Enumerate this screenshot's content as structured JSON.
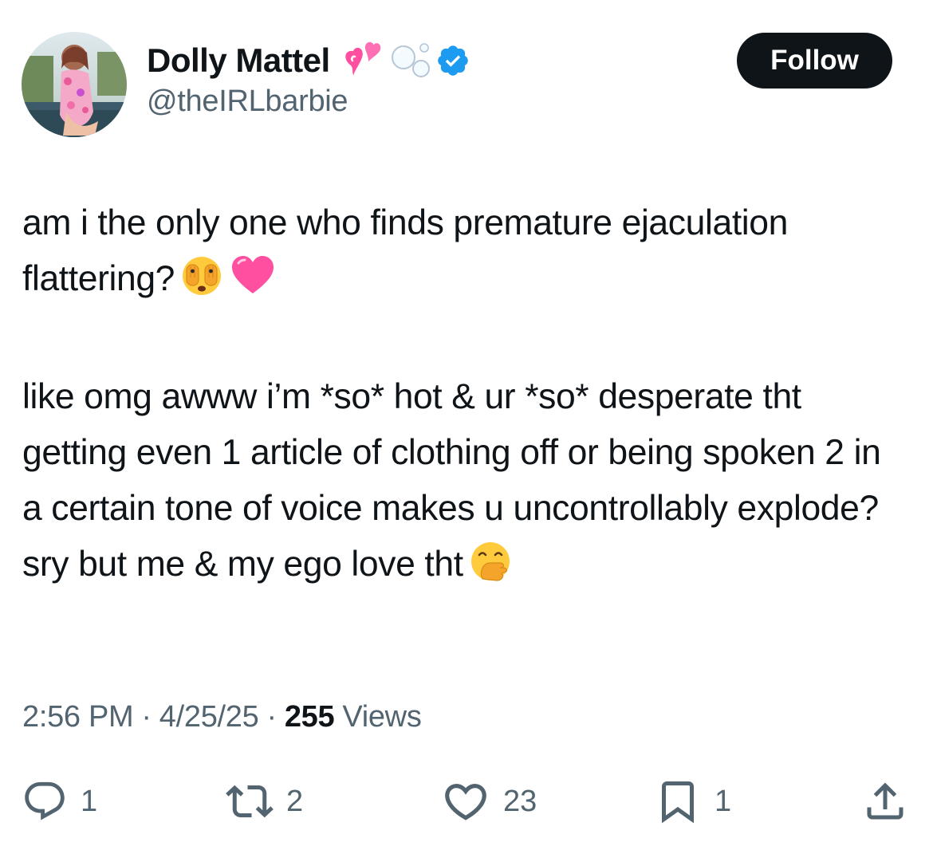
{
  "author": {
    "display_name": "Dolly Mattel",
    "handle": "@theIRLbarbie",
    "avatar_icon": "profile-photo",
    "badges": [
      "two-hearts-emoji",
      "bubbles-emoji",
      "verified-badge-icon"
    ],
    "verified_color": "#1d9bf0"
  },
  "follow_button": {
    "label": "Follow"
  },
  "tweet": {
    "paragraph1_text": "am i the only one who finds premature ejaculation flattering?",
    "paragraph1_emojis": [
      "face-with-peeking-eye-emoji",
      "pink-heart-emoji"
    ],
    "paragraph2_text": "like omg awww i’m *so* hot & ur *so* desperate tht getting even 1 article of clothing off or being spoken 2 in a certain tone of voice makes u uncontrollably explode? sry but me & my ego love tht",
    "paragraph2_emojis": [
      "face-with-hand-over-mouth-emoji"
    ]
  },
  "meta": {
    "time": "2:56 PM",
    "separator": "·",
    "date": "4/25/25",
    "views_count": "255",
    "views_label": "Views"
  },
  "actions": {
    "reply": {
      "icon": "reply-icon",
      "count": "1"
    },
    "repost": {
      "icon": "repost-icon",
      "count": "2"
    },
    "like": {
      "icon": "heart-icon",
      "count": "23"
    },
    "bookmark": {
      "icon": "bookmark-icon",
      "count": "1"
    },
    "share": {
      "icon": "share-icon"
    }
  },
  "colors": {
    "text_primary": "#0f1419",
    "text_secondary": "#536471",
    "follow_bg": "#0f1419",
    "accent_pink": "#ff4fa0"
  }
}
